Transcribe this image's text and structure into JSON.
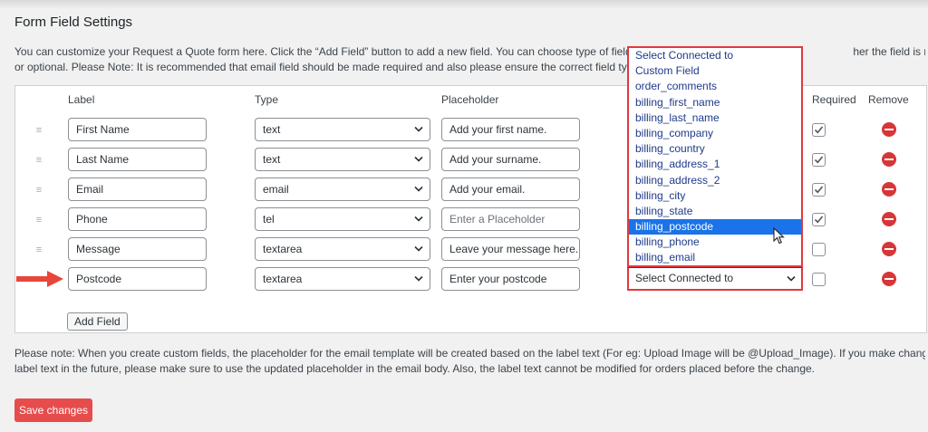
{
  "page": {
    "title": "Form Field Settings",
    "intro_line1": "You can customize your Request a Quote form here. Click the “Add Field” button to add a new field. You can choose type of field from th",
    "intro_line1_right": "her the field is required",
    "intro_line2": "or optional. Please Note: It is recommended that email field should be made required and also please ensure the correct field type is cho"
  },
  "table": {
    "headers": {
      "label": "Label",
      "type": "Type",
      "placeholder": "Placeholder",
      "required": "Required",
      "remove": "Remove"
    },
    "rows": [
      {
        "label": "First Name",
        "type": "text",
        "placeholder": "Add your first name.",
        "placeholder_is_hint": false,
        "required": true
      },
      {
        "label": "Last Name",
        "type": "text",
        "placeholder": "Add your surname.",
        "placeholder_is_hint": false,
        "required": true
      },
      {
        "label": "Email",
        "type": "email",
        "placeholder": "Add your email.",
        "placeholder_is_hint": false,
        "required": true
      },
      {
        "label": "Phone",
        "type": "tel",
        "placeholder": "Enter a Placeholder",
        "placeholder_is_hint": true,
        "required": true
      },
      {
        "label": "Message",
        "type": "textarea",
        "placeholder": "Leave your message here.",
        "placeholder_is_hint": false,
        "required": false
      },
      {
        "label": "Postcode",
        "type": "textarea",
        "placeholder": "Enter your postcode",
        "placeholder_is_hint": false,
        "required": false,
        "connected_to": "Select Connected to"
      }
    ],
    "drag_handle": "≡"
  },
  "connected_dropdown": {
    "selected": "Select Connected to",
    "highlighted": "billing_postcode",
    "options": [
      "Select Connected to",
      "Custom Field",
      "order_comments",
      "billing_first_name",
      "billing_last_name",
      "billing_company",
      "billing_country",
      "billing_address_1",
      "billing_address_2",
      "billing_city",
      "billing_state",
      "billing_postcode",
      "billing_phone",
      "billing_email"
    ]
  },
  "buttons": {
    "add_field": "Add Field",
    "save_changes": "Save changes"
  },
  "note": {
    "line1": "Please note: When you create custom fields, the placeholder for the email template will be created based on the label text (For eg: Upload Image will be @Upload_Image). If you make changes to the",
    "line2": "label text in the future, please make sure to use the updated placeholder in the email body. Also, the label text cannot be modified for orders placed before the change."
  },
  "colors": {
    "highlight_border": "#e0393e",
    "arrow": "#e8463a",
    "remove_icon": "#d63638",
    "save_button": "#e74c4c",
    "option_active_bg": "#1a73e8"
  }
}
